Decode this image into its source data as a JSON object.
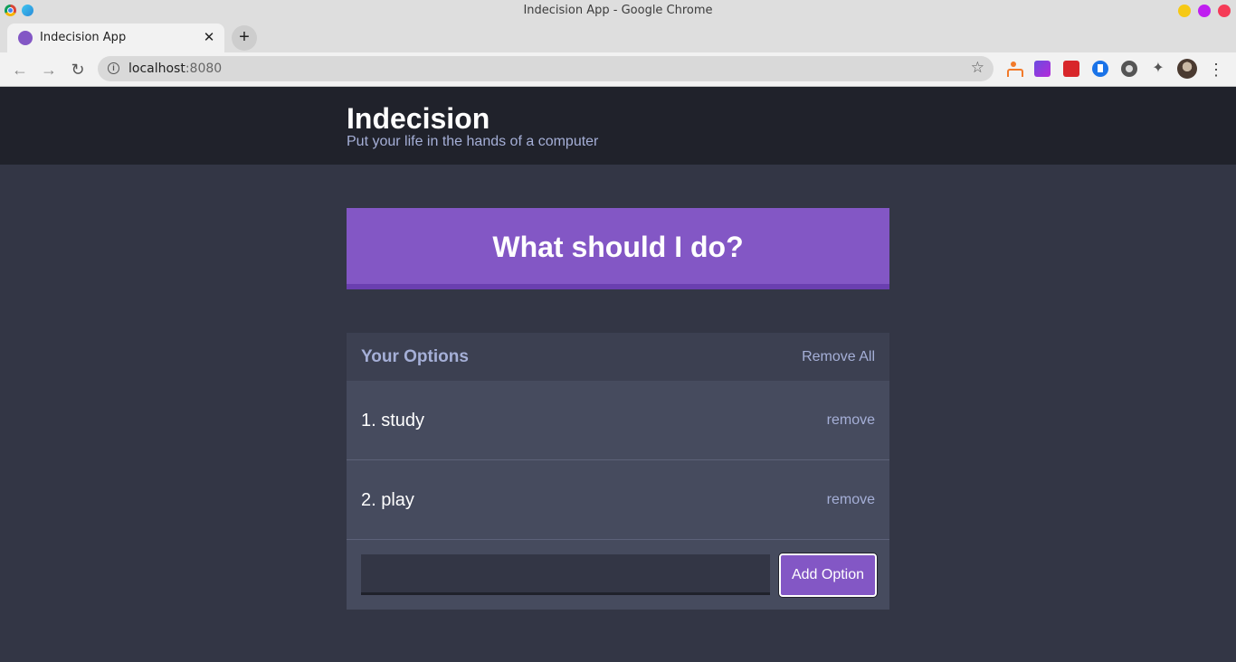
{
  "window": {
    "title": "Indecision App - Google Chrome"
  },
  "browser": {
    "tab": {
      "title": "Indecision App",
      "close_glyph": "✕"
    },
    "new_tab_glyph": "+",
    "address": {
      "host": "localhost",
      "port": ":8080"
    },
    "back_glyph": "←",
    "forward_glyph": "→",
    "reload_glyph": "↻",
    "star_glyph": "☆",
    "menu_glyph": "⋮",
    "puzzle_glyph": "✦",
    "icons": [
      "chrome-logo-icon",
      "circle-app-icon",
      "info-icon",
      "star-icon",
      "extension-icon",
      "puzzle-icon",
      "avatar",
      "menu-dots-icon"
    ]
  },
  "app": {
    "title": "Indecision",
    "subtitle": "Put your life in the hands of a computer",
    "big_button_label": "What should I do?",
    "widget": {
      "title": "Your Options",
      "remove_all_label": "Remove All",
      "options": [
        {
          "text": "1. study",
          "remove_label": "remove"
        },
        {
          "text": "2. play",
          "remove_label": "remove"
        }
      ],
      "input_value": "",
      "add_button_label": "Add Option"
    }
  },
  "colors": {
    "accent": "#8357c5",
    "header_bg": "#20222b",
    "page_bg": "#333645",
    "widget_bg": "#464b5e",
    "widget_header_bg": "#3c4051",
    "muted_text": "#a5afd7"
  }
}
